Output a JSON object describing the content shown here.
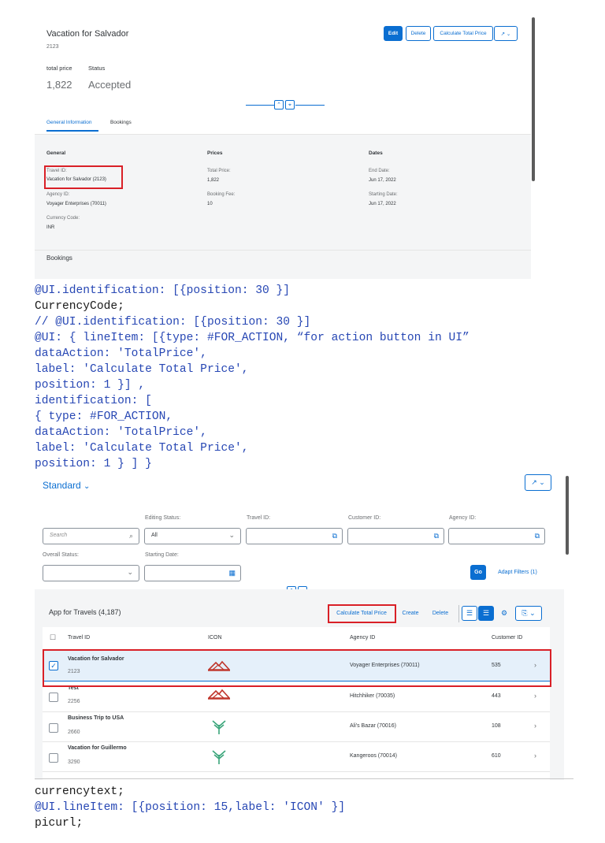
{
  "object_page": {
    "title": "Vacation for Salvador",
    "subtitle": "2123",
    "kpis": [
      {
        "label": "total price",
        "value": "1,822"
      },
      {
        "label": "Status",
        "value": "Accepted"
      }
    ],
    "actions": {
      "edit": "Edit",
      "delete": "Delete",
      "calc": "Calculate Total Price",
      "share_icon": "share-icon",
      "dropdown_icon": "chevron-down-icon"
    },
    "tabs": [
      "General Information",
      "Bookings"
    ],
    "sections": {
      "general": {
        "heading": "General",
        "fields": [
          {
            "label": "Travel ID:",
            "value": "Vacation for Salvador (2123)"
          },
          {
            "label": "Agency ID:",
            "value": "Voyager Enterprises (70011)"
          },
          {
            "label": "Currency Code:",
            "value": "INR"
          }
        ]
      },
      "prices": {
        "heading": "Prices",
        "fields": [
          {
            "label": "Total Price:",
            "value": "1,822"
          },
          {
            "label": "Booking Fee:",
            "value": "10"
          }
        ]
      },
      "dates": {
        "heading": "Dates",
        "fields": [
          {
            "label": "End Date:",
            "value": "Jun 17, 2022"
          },
          {
            "label": "Starting Date:",
            "value": "Jun 17, 2022"
          }
        ]
      }
    },
    "bookings_heading": "Bookings"
  },
  "code_block_1": {
    "lines": [
      "@UI.identification: [{position: 30 }]",
      "CurrencyCode;",
      "// @UI.identification: [{position: 30 }]",
      "@UI: { lineItem: [{type: #FOR_ACTION, “for action button in UI”",
      "dataAction: 'TotalPrice',",
      "label: 'Calculate Total Price',",
      "position: 1 }] ,",
      "identification: [",
      "{ type: #FOR_ACTION,",
      "dataAction: 'TotalPrice',",
      "label: 'Calculate Total Price',",
      "position: 1 } ] }"
    ]
  },
  "list_report": {
    "variant": "Standard",
    "filters": {
      "search_placeholder": "Search",
      "editing_status_label": "Editing Status:",
      "editing_status_value": "All",
      "travel_id_label": "Travel ID:",
      "customer_id_label": "Customer ID:",
      "agency_id_label": "Agency ID:",
      "overall_status_label": "Overall Status:",
      "starting_date_label": "Starting Date:",
      "go": "Go",
      "adapt": "Adapt Filters (1)"
    },
    "table": {
      "title": "App for Travels (4,187)",
      "toolbar": {
        "calc": "Calculate Total Price",
        "create": "Create",
        "delete": "Delete"
      },
      "columns": [
        "Travel ID",
        "ICON",
        "Agency ID",
        "Customer ID"
      ],
      "rows": [
        {
          "title": "Vacation for Salvador",
          "id": "2123",
          "agency": "Voyager Enterprises (70011)",
          "customer": "535",
          "icon": "airline-logo-red",
          "selected": true
        },
        {
          "title": "Test",
          "id": "2256",
          "agency": "Hitchhiker (70035)",
          "customer": "443",
          "icon": "airline-logo-red",
          "selected": false
        },
        {
          "title": "Business Trip to USA",
          "id": "2660",
          "agency": "Ali's Bazar (70016)",
          "customer": "108",
          "icon": "airline-logo-green",
          "selected": false
        },
        {
          "title": "Vacation for Guillermo",
          "id": "3290",
          "agency": "Kangeroos (70014)",
          "customer": "610",
          "icon": "airline-logo-green",
          "selected": false
        }
      ]
    }
  },
  "code_block_2": {
    "lines": [
      "currencytext;",
      "@UI.lineItem: [{position: 15,label: 'ICON' }]",
      "picurl;"
    ]
  },
  "colors": {
    "accent": "#0a6ed1",
    "highlight": "#d92027",
    "code": "#2747b4"
  }
}
